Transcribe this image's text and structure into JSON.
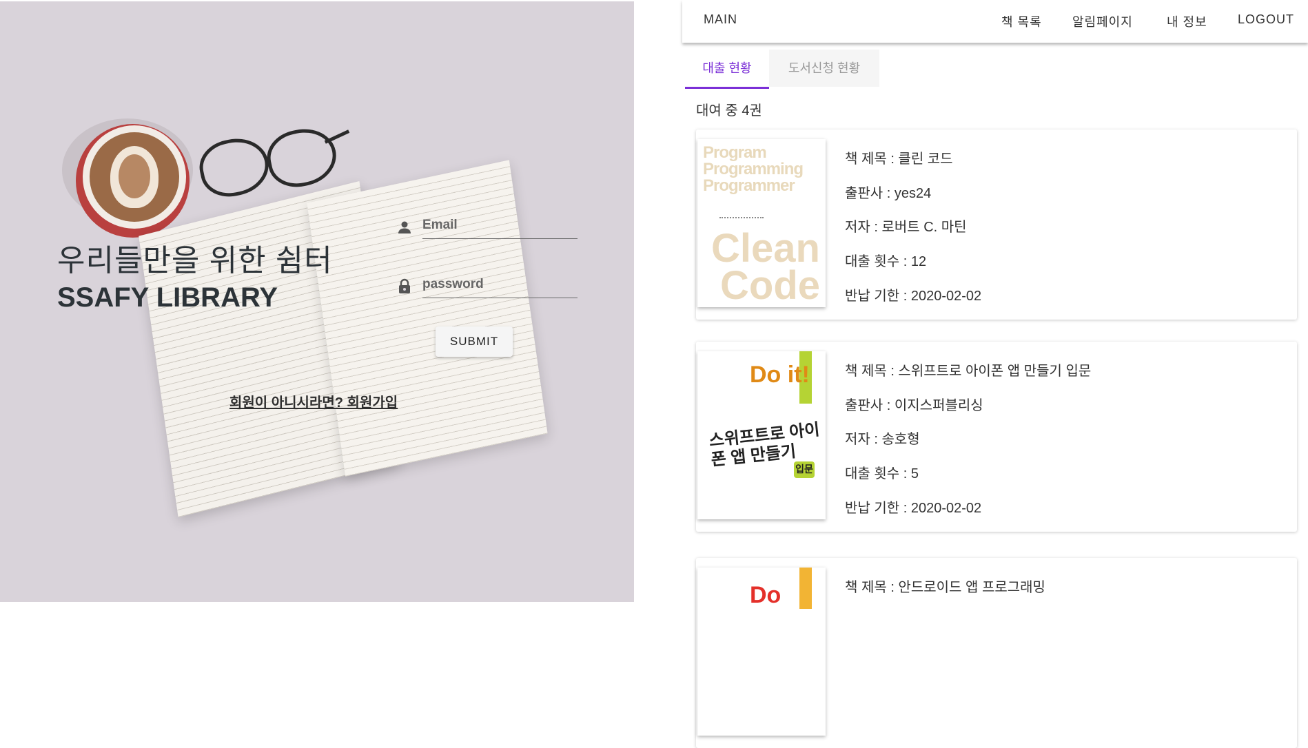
{
  "login": {
    "title": "우리들만을 위한 쉼터",
    "subtitle": "SSAFY LIBRARY",
    "email_placeholder": "Email",
    "password_placeholder": "password",
    "submit_label": "SUBMIT",
    "signup_link": "회원이 아니시라면? 회원가입"
  },
  "nav": {
    "main": "MAIN",
    "items": [
      "책 목록",
      "알림페이지",
      "내 정보",
      "LOGOUT"
    ]
  },
  "tabs": [
    "대출 현황",
    "도서신청 현황"
  ],
  "rental_count": "대여 중 4권",
  "books": [
    {
      "title": "책 제목 : 클린 코드",
      "publisher": "출판사 : yes24",
      "author": "저자 : 로버트 C. 마틴",
      "loans": "대출 횟수 : 12",
      "due": "반납 기한 : 2020-02-02",
      "cover_text": [
        "Program",
        "Programming",
        "Programmer"
      ],
      "cover_big": [
        "Clean",
        "Code"
      ]
    },
    {
      "title": "책 제목 : 스위프트로 아이폰 앱 만들기 입문",
      "publisher": "출판사 : 이지스퍼블리싱",
      "author": "저자 : 송호형",
      "loans": "대출 횟수 : 5",
      "due": "반납 기한 : 2020-02-02",
      "cover_doit": "Do it!",
      "cover_title": "스위프트로 아이폰 앱 만들기",
      "cover_badge": "입문"
    },
    {
      "title": "책 제목 : 안드로이드 앱 프로그래밍",
      "cover_doit": "Do"
    }
  ],
  "colors": {
    "accent": "#7b30d7",
    "panel_bg": "#d9d3da"
  }
}
